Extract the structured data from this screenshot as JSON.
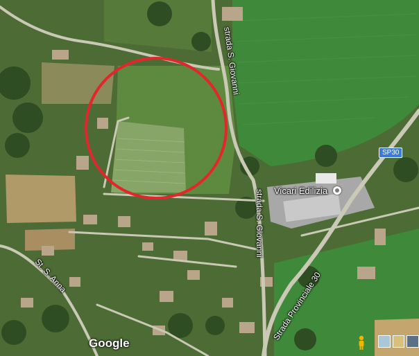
{
  "map": {
    "roads": {
      "strada_s_giovanni_north": "strada S. Giovanni",
      "strada_s_giovanni_south": "strada S. Giovanni",
      "st_s_anna": "St. S. Anna",
      "strada_provinciale_30": "Strada Provinciale 30",
      "route_shield": "SP30"
    },
    "poi": {
      "name": "Vicari Edilizia",
      "icon": "poi-dot-icon"
    },
    "highlight": {
      "shape": "circle",
      "color": "#e3262c"
    },
    "attribution": "Google",
    "controls": {
      "pegman": "pegman-icon",
      "layers": [
        "satellite",
        "terrain",
        "map"
      ]
    }
  }
}
